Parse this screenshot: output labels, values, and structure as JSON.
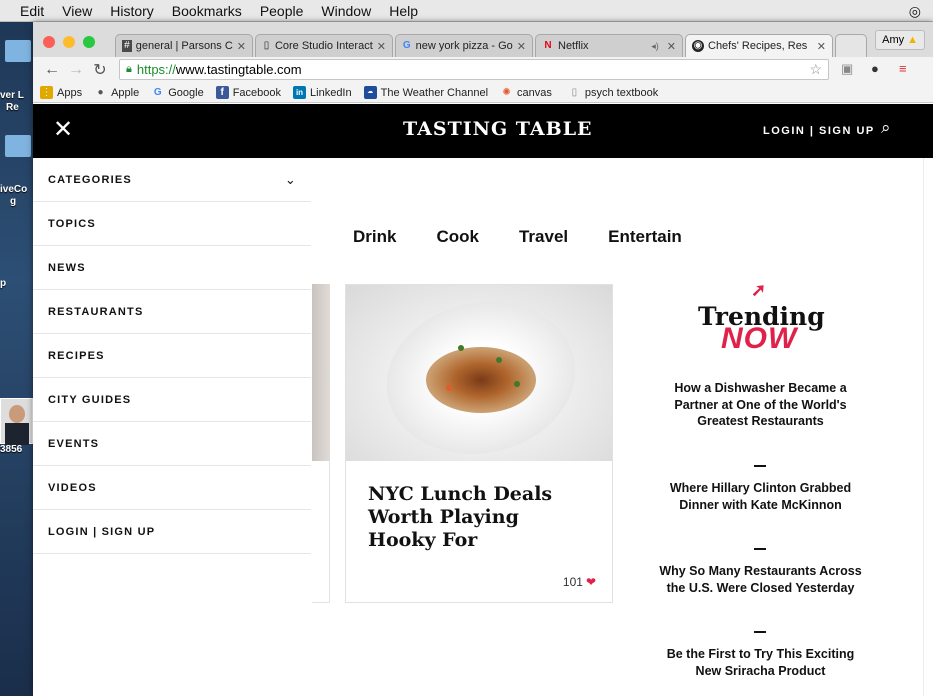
{
  "menubar": {
    "items": [
      "Edit",
      "View",
      "History",
      "Bookmarks",
      "People",
      "Window",
      "Help"
    ]
  },
  "desktop": {
    "fragments": [
      "ver L",
      "Re",
      "iveCo",
      "g",
      "p",
      "3856"
    ]
  },
  "browser": {
    "tabs": [
      {
        "label": "general | Parsons C",
        "icon": "slack-icon"
      },
      {
        "label": "Core Studio Interact",
        "icon": "document-icon"
      },
      {
        "label": "new york pizza - Go",
        "icon": "google-icon"
      },
      {
        "label": "Netflix",
        "icon": "netflix-icon"
      },
      {
        "label": "Chefs' Recipes, Res",
        "icon": "tastingtable-icon"
      }
    ],
    "profile": "Amy",
    "url_scheme": "https://",
    "url_host": "www.tastingtable.com",
    "bookmarks": [
      {
        "label": "Apps",
        "icon": "apps-icon",
        "color": "#e0a800"
      },
      {
        "label": "Apple",
        "icon": "apple-icon",
        "color": "#555555"
      },
      {
        "label": "Google",
        "icon": "google-icon",
        "color": "#4285f4"
      },
      {
        "label": "Facebook",
        "icon": "facebook-icon",
        "color": "#3b5998"
      },
      {
        "label": "LinkedIn",
        "icon": "linkedin-icon",
        "color": "#0077b5"
      },
      {
        "label": "The Weather Channel",
        "icon": "weather-icon",
        "color": "#1f4d99"
      },
      {
        "label": "canvas",
        "icon": "canvas-icon",
        "color": "#e4582b"
      },
      {
        "label": "psych textbook",
        "icon": "document-icon",
        "color": "#888888"
      }
    ]
  },
  "site": {
    "logo": "TASTING TABLE",
    "login": "LOGIN | SIGN UP",
    "menu": [
      "CATEGORIES",
      "TOPICS",
      "NEWS",
      "RESTAURANTS",
      "RECIPES",
      "CITY GUIDES",
      "EVENTS",
      "VIDEOS",
      "LOGIN | SIGN UP"
    ],
    "nav": [
      "Drink",
      "Cook",
      "Travel",
      "Entertain"
    ],
    "card": {
      "title": "NYC Lunch Deals Worth Playing Hooky For",
      "likes": "101"
    },
    "trending": {
      "title": "Trending",
      "now": "NOW",
      "stories": [
        "How a Dishwasher Became a Partner at One of the World's Greatest Restaurants",
        "Where Hillary Clinton Grabbed Dinner with Kate McKinnon",
        "Why So Many Restaurants Across the U.S. Were Closed Yesterday",
        "Be the First to Try This Exciting New Sriracha Product"
      ]
    },
    "accent_color": "#e0224b"
  }
}
